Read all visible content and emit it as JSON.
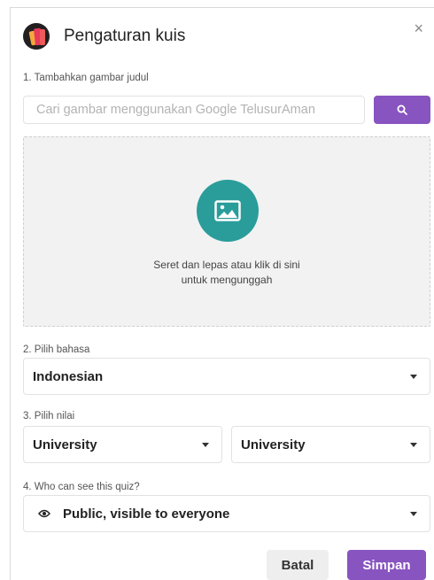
{
  "dialog": {
    "title": "Pengaturan kuis",
    "close_label": "×"
  },
  "step1": {
    "label": "1. Tambahkan gambar judul",
    "search_placeholder": "Cari gambar menggunakan Google TelusurAman",
    "search_value": "",
    "dropzone_line1": "Seret dan lepas atau klik di sini",
    "dropzone_line2": "untuk mengunggah"
  },
  "step2": {
    "label": "2. Pilih bahasa",
    "selected": "Indonesian"
  },
  "step3": {
    "label": "3. Pilih nilai",
    "from": "University",
    "to": "University"
  },
  "step4": {
    "label": "4. Who can see this quiz?",
    "selected": "Public, visible to everyone",
    "icon": "eye-icon"
  },
  "footer": {
    "cancel_label": "Batal",
    "save_label": "Simpan"
  },
  "colors": {
    "accent": "#8854c0",
    "teal": "#2a9d9b",
    "dropzone_bg": "#f2f2f2"
  }
}
